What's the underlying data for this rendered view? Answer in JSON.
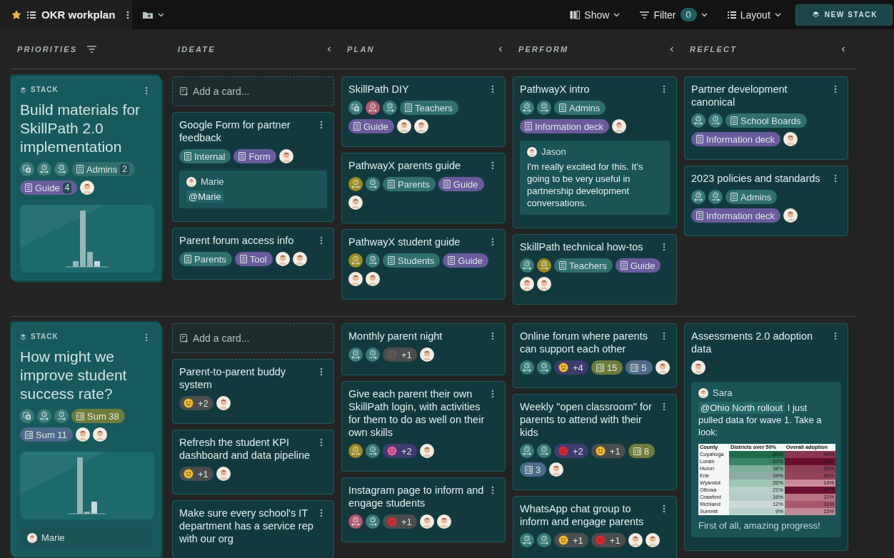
{
  "topbar": {
    "starred": true,
    "title": "OKR workplan",
    "show": "Show",
    "filter": "Filter",
    "filter_count": "0",
    "layout": "Layout",
    "new_stack": "NEW STACK"
  },
  "columns": [
    {
      "label": "PRIORITIES"
    },
    {
      "label": "IDEATE"
    },
    {
      "label": "PLAN"
    },
    {
      "label": "PERFORM"
    },
    {
      "label": "REFLECT"
    }
  ],
  "rows": [
    {
      "stack": {
        "label": "STACK",
        "title": "Build materials for SkillPath 2.0 implementation",
        "chips": [
          {
            "kind": "copy",
            "color": "#3a7b78"
          },
          {
            "kind": "owner",
            "color": "#3a7b78"
          },
          {
            "kind": "reviewer",
            "color": "#3a7b78"
          },
          {
            "kind": "tag",
            "label": "Admins",
            "count": "2",
            "color": "#2f706c"
          },
          {
            "kind": "tag",
            "label": "Guide",
            "count": "4",
            "color": "#6b5b9e"
          },
          {
            "kind": "avatar"
          }
        ]
      },
      "lanes": [
        {
          "add_card": "Add a card...",
          "cards": [
            {
              "title": "Google Form for partner feedback",
              "chips": [
                {
                  "kind": "tag",
                  "label": "Internal",
                  "color": "#2f706c"
                },
                {
                  "kind": "tag",
                  "label": "Form",
                  "color": "#6b5b9e"
                },
                {
                  "kind": "avatar"
                }
              ],
              "comment": {
                "author": "Marie",
                "mention": "@Marie"
              }
            },
            {
              "title": "Parent forum access info",
              "chips": [
                {
                  "kind": "tag",
                  "label": "Parents",
                  "color": "#2f706c"
                },
                {
                  "kind": "tag",
                  "label": "Tool",
                  "color": "#6b5b9e"
                },
                {
                  "kind": "avatar"
                },
                {
                  "kind": "avatar"
                }
              ]
            }
          ]
        },
        {
          "cards": [
            {
              "title": "SkillPath DIY",
              "chips": [
                {
                  "kind": "copy",
                  "color": "#3a7b78"
                },
                {
                  "kind": "owner",
                  "color": "#b5556e"
                },
                {
                  "kind": "reviewer",
                  "color": "#3a7b78"
                },
                {
                  "kind": "tag",
                  "label": "Teachers",
                  "color": "#2f706c"
                },
                {
                  "kind": "tag",
                  "label": "Guide",
                  "color": "#6b5b9e"
                },
                {
                  "kind": "avatar"
                },
                {
                  "kind": "avatar"
                }
              ]
            },
            {
              "title": "PathwayX parents guide",
              "chips": [
                {
                  "kind": "owner",
                  "color": "#a08a1c"
                },
                {
                  "kind": "reviewer",
                  "color": "#3a7b78"
                },
                {
                  "kind": "tag",
                  "label": "Parents",
                  "color": "#2f706c"
                },
                {
                  "kind": "tag",
                  "label": "Guide",
                  "color": "#6b5b9e"
                },
                {
                  "kind": "avatar"
                }
              ]
            },
            {
              "title": "PathwayX student guide",
              "chips": [
                {
                  "kind": "owner",
                  "color": "#a08a1c"
                },
                {
                  "kind": "reviewer",
                  "color": "#3a7b78"
                },
                {
                  "kind": "tag",
                  "label": "Students",
                  "color": "#2f706c"
                },
                {
                  "kind": "tag",
                  "label": "Guide",
                  "color": "#6b5b9e"
                },
                {
                  "kind": "avatar"
                },
                {
                  "kind": "avatar"
                }
              ]
            }
          ]
        },
        {
          "cards": [
            {
              "title": "PathwayX intro",
              "chips": [
                {
                  "kind": "owner",
                  "color": "#3a7b78"
                },
                {
                  "kind": "reviewer",
                  "color": "#3a7b78"
                },
                {
                  "kind": "tag",
                  "label": "Admins",
                  "color": "#2f706c"
                },
                {
                  "kind": "tag",
                  "label": "Information deck",
                  "color": "#6b5b9e"
                },
                {
                  "kind": "avatar"
                }
              ],
              "comment": {
                "author": "Jason",
                "text": "I'm really excited for this. It's going to be very useful in partnership development conversations."
              }
            },
            {
              "title": "SkillPath technical how-tos",
              "chips": [
                {
                  "kind": "owner",
                  "color": "#3a7b78"
                },
                {
                  "kind": "reviewer",
                  "color": "#a08a1c"
                },
                {
                  "kind": "tag",
                  "label": "Teachers",
                  "color": "#2f706c"
                },
                {
                  "kind": "tag",
                  "label": "Guide",
                  "color": "#6b5b9e"
                },
                {
                  "kind": "avatar"
                },
                {
                  "kind": "avatar"
                }
              ]
            }
          ]
        },
        {
          "cards": [
            {
              "title": "Partner development canonical",
              "chips": [
                {
                  "kind": "owner",
                  "color": "#3a7b78"
                },
                {
                  "kind": "reviewer",
                  "color": "#3a7b78"
                },
                {
                  "kind": "tag",
                  "label": "School Boards",
                  "color": "#2f706c"
                },
                {
                  "kind": "tag",
                  "label": "Information deck",
                  "color": "#6b5b9e"
                },
                {
                  "kind": "avatar"
                }
              ]
            },
            {
              "title": "2023 policies and standards",
              "chips": [
                {
                  "kind": "owner",
                  "color": "#3a7b78"
                },
                {
                  "kind": "reviewer",
                  "color": "#3a7b78"
                },
                {
                  "kind": "tag",
                  "label": "Admins",
                  "color": "#2f706c"
                },
                {
                  "kind": "tag",
                  "label": "Information deck",
                  "color": "#6b5b9e"
                },
                {
                  "kind": "avatar"
                }
              ]
            }
          ]
        }
      ]
    },
    {
      "stack": {
        "label": "STACK",
        "title": "How might we improve student success rate?",
        "chips": [
          {
            "kind": "copy",
            "color": "#3a7b78"
          },
          {
            "kind": "owner",
            "color": "#3a7b78"
          },
          {
            "kind": "reviewer",
            "color": "#3a7b78"
          },
          {
            "kind": "number",
            "label": "Sum 38",
            "color": "#6f7d3c"
          },
          {
            "kind": "number",
            "label": "Sum 11",
            "color": "#4d6a8c"
          },
          {
            "kind": "avatar"
          },
          {
            "kind": "avatar"
          }
        ],
        "comment": {
          "author": "Marie"
        }
      },
      "lanes": [
        {
          "add_card": "Add a card...",
          "cards": [
            {
              "title": "Parent-to-parent buddy system",
              "chips": [
                {
                  "kind": "reaction",
                  "count": "+2",
                  "reacted": false,
                  "color": "#f2b92c"
                },
                {
                  "kind": "avatar"
                }
              ]
            },
            {
              "title": "Refresh the student KPI dashboard and data pipeline",
              "chips": [
                {
                  "kind": "reaction",
                  "count": "+1",
                  "reacted": false,
                  "color": "#f2b92c"
                },
                {
                  "kind": "avatar"
                }
              ]
            },
            {
              "title": "Make sure every school's IT department has a service rep with our org"
            }
          ]
        },
        {
          "cards": [
            {
              "title": "Monthly parent night",
              "chips": [
                {
                  "kind": "owner",
                  "color": "#3a7b78"
                },
                {
                  "kind": "reviewer",
                  "color": "#3a7b78"
                },
                {
                  "kind": "reaction",
                  "count": "+1",
                  "reacted": false,
                  "color": "#5a5a5a"
                },
                {
                  "kind": "avatar"
                }
              ]
            },
            {
              "title": "Give each parent their own SkillPath login, with activities for them to do as well on their own skills",
              "chips": [
                {
                  "kind": "owner",
                  "color": "#a08a1c"
                },
                {
                  "kind": "reviewer",
                  "color": "#3a7b78"
                },
                {
                  "kind": "reaction",
                  "count": "+2",
                  "reacted": true,
                  "color": "#e45aa6"
                },
                {
                  "kind": "avatar"
                }
              ]
            },
            {
              "title": "Instagram page to inform and engage students",
              "chips": [
                {
                  "kind": "owner",
                  "color": "#b5556e"
                },
                {
                  "kind": "reviewer",
                  "color": "#3a7b78"
                },
                {
                  "kind": "reaction",
                  "count": "+1",
                  "reacted": false,
                  "color": "#d42a3a"
                },
                {
                  "kind": "avatar"
                },
                {
                  "kind": "avatar"
                }
              ]
            }
          ]
        },
        {
          "cards": [
            {
              "title": "Online forum where parents can support each other",
              "chips": [
                {
                  "kind": "owner",
                  "color": "#3a7b78"
                },
                {
                  "kind": "reviewer",
                  "color": "#3a7b78"
                },
                {
                  "kind": "reaction",
                  "count": "+4",
                  "reacted": true,
                  "color": "#f2b92c"
                },
                {
                  "kind": "number",
                  "label": "15",
                  "color": "#6f7d3c"
                },
                {
                  "kind": "number",
                  "label": "5",
                  "color": "#4d6a8c"
                },
                {
                  "kind": "avatar"
                }
              ]
            },
            {
              "title": "Weekly \"open classroom\" for parents to attend with their kids",
              "chips": [
                {
                  "kind": "owner",
                  "color": "#3a7b78"
                },
                {
                  "kind": "reviewer",
                  "color": "#3a7b78"
                },
                {
                  "kind": "reaction",
                  "count": "+2",
                  "reacted": true,
                  "color": "#e0242e"
                },
                {
                  "kind": "reaction",
                  "count": "+1",
                  "reacted": false,
                  "color": "#f2b92c"
                },
                {
                  "kind": "number",
                  "label": "8",
                  "color": "#6f7d3c"
                },
                {
                  "kind": "number",
                  "label": "3",
                  "color": "#4d6a8c"
                },
                {
                  "kind": "avatar"
                }
              ]
            },
            {
              "title": "WhatsApp chat group to inform and engage parents",
              "chips": [
                {
                  "kind": "owner",
                  "color": "#3a7b78"
                },
                {
                  "kind": "reviewer",
                  "color": "#3a7b78"
                },
                {
                  "kind": "reaction",
                  "count": "+1",
                  "reacted": false,
                  "color": "#f2b92c"
                },
                {
                  "kind": "reaction",
                  "count": "+1",
                  "reacted": false,
                  "color": "#e0242e"
                },
                {
                  "kind": "avatar"
                },
                {
                  "kind": "avatar"
                }
              ]
            }
          ]
        },
        {
          "cards": [
            {
              "title": "Assessments 2.0 adoption data",
              "chips": [
                {
                  "kind": "avatar"
                }
              ],
              "comment": {
                "author": "Sara",
                "mention": "@Ohio North rollout",
                "text": " I just pulled data for wave 1. Take a look:",
                "table": {
                  "headers": [
                    "County",
                    "Districts over 50%",
                    "Overall adoption"
                  ],
                  "rows": [
                    {
                      "cells": [
                        {
                          "text": "Cuyahoga"
                        },
                        {
                          "text": "80%",
                          "color": "#1e6b4a"
                        },
                        {
                          "text": "49%",
                          "color": "#8c3550"
                        }
                      ]
                    },
                    {
                      "cells": [
                        {
                          "text": "Lorain"
                        },
                        {
                          "text": "63%",
                          "color": "#3a8266"
                        },
                        {
                          "text": "68%",
                          "color": "#6a0e30"
                        }
                      ]
                    },
                    {
                      "cells": [
                        {
                          "text": "Huron"
                        },
                        {
                          "text": "38%",
                          "color": "#7fb09a"
                        },
                        {
                          "text": "45%",
                          "color": "#8e4057"
                        }
                      ]
                    },
                    {
                      "cells": [
                        {
                          "text": "Erie"
                        },
                        {
                          "text": "34%",
                          "color": "#8eaba8"
                        },
                        {
                          "text": "44%",
                          "color": "#93455c"
                        }
                      ]
                    },
                    {
                      "cells": [
                        {
                          "text": "Wyandot"
                        },
                        {
                          "text": "26%",
                          "color": "#9ec7b5"
                        },
                        {
                          "text": "14%",
                          "color": "#c9899a"
                        }
                      ]
                    },
                    {
                      "cells": [
                        {
                          "text": "Ottowa"
                        },
                        {
                          "text": "21%",
                          "color": "#b7cfca"
                        },
                        {
                          "text": "67%",
                          "color": "#6c1032"
                        }
                      ]
                    },
                    {
                      "cells": [
                        {
                          "text": "Crawford"
                        },
                        {
                          "text": "16%",
                          "color": "#b3ccc7"
                        },
                        {
                          "text": "22%",
                          "color": "#b97584"
                        }
                      ]
                    },
                    {
                      "cells": [
                        {
                          "text": "Richland"
                        },
                        {
                          "text": "12%",
                          "color": "#cdd9d8"
                        },
                        {
                          "text": "31%",
                          "color": "#a85a6c"
                        }
                      ]
                    },
                    {
                      "cells": [
                        {
                          "text": "Summit"
                        },
                        {
                          "text": "9%",
                          "color": "#b9d1cc"
                        },
                        {
                          "text": "15%",
                          "color": "#c08a96"
                        }
                      ]
                    }
                  ]
                },
                "after": "First of all, amazing progress!"
              }
            }
          ]
        }
      ]
    }
  ]
}
